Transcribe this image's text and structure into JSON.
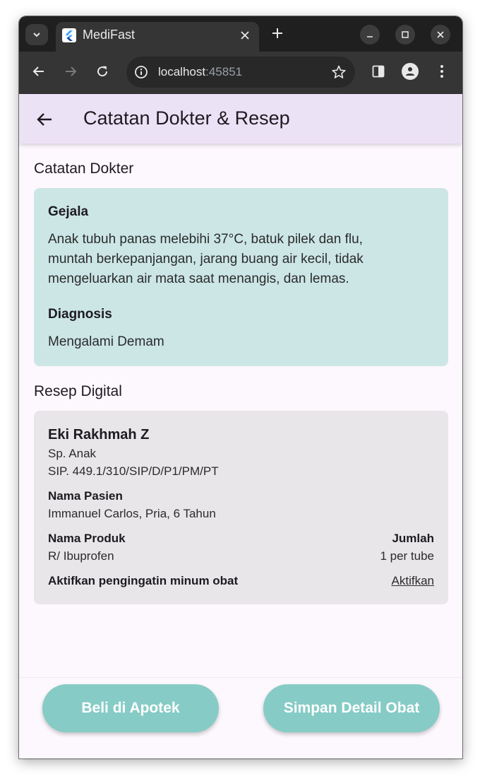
{
  "browser": {
    "tab_title": "MediFast",
    "url_host": "localhost",
    "url_port": ":45851"
  },
  "appbar": {
    "title": "Catatan Dokter & Resep"
  },
  "notes": {
    "section_title": "Catatan Dokter",
    "symptoms_label": "Gejala",
    "symptoms_lines": [
      "Anak tubuh panas melebihi 37°C, batuk pilek dan flu,",
      "muntah berkepanjangan, jarang buang air kecil, tidak",
      "mengeluarkan air mata saat menangis, dan lemas."
    ],
    "diagnosis_label": "Diagnosis",
    "diagnosis_text": "Mengalami Demam"
  },
  "prescription": {
    "section_title": "Resep Digital",
    "doctor_name": "Eki Rakhmah Z",
    "specialty": "Sp. Anak",
    "sip": "SIP. 449.1/310/SIP/D/P1/PM/PT",
    "patient_label": "Nama Pasien",
    "patient_value": "Immanuel Carlos, Pria, 6 Tahun",
    "product_label": "Nama Produk",
    "product_value": "R/ Ibuprofen",
    "qty_label": "Jumlah",
    "qty_value": "1 per tube",
    "reminder_label": "Aktifkan pengingatin minum obat",
    "reminder_link": "Aktifkan"
  },
  "actions": {
    "buy_label": "Beli di Apotek",
    "save_label": "Simpan Detail Obat"
  },
  "colors": {
    "appbar_bg": "#ece2f6",
    "notes_card_bg": "#cce6e6",
    "rx_card_bg": "#e8e6e9",
    "button_bg": "#86cbc6"
  }
}
